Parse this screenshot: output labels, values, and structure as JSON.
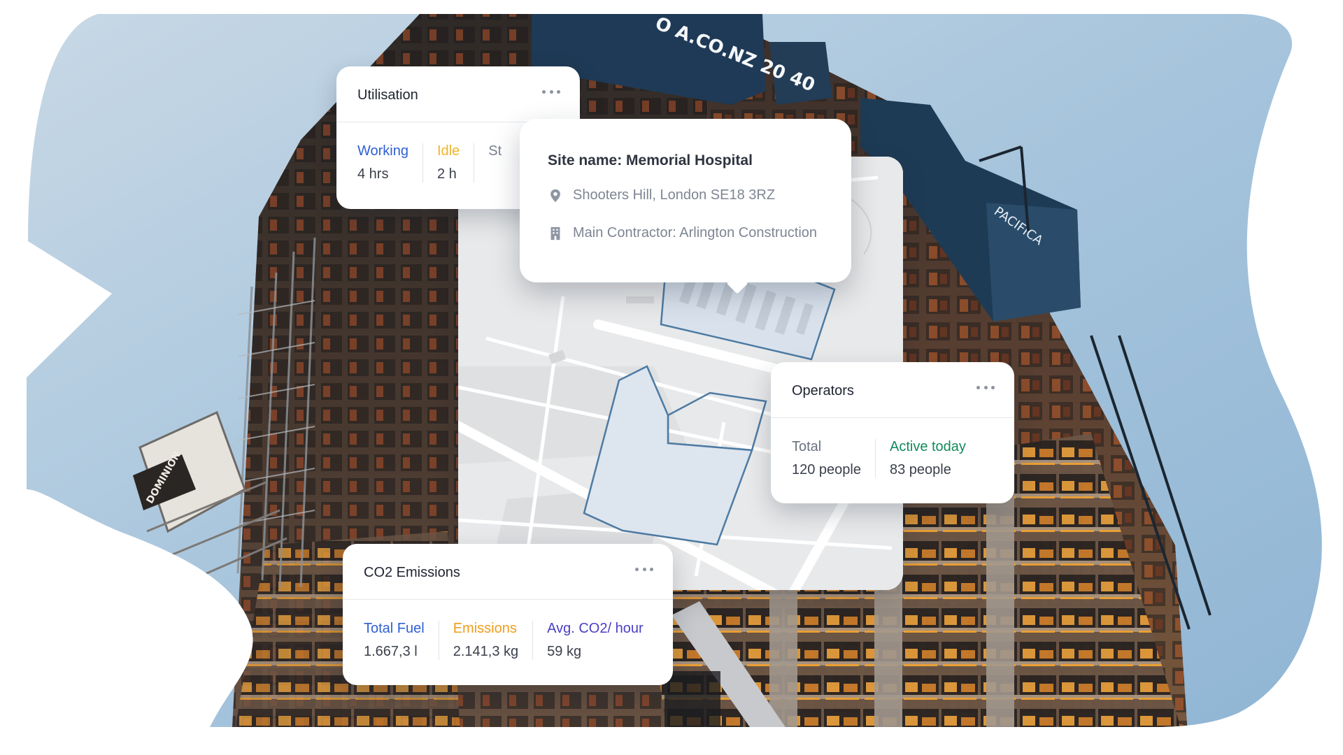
{
  "colors": {
    "working": "#2f5fd6",
    "idle": "#f0b429",
    "standby": "#7b8190",
    "total": "#6b7280",
    "active": "#148a5c",
    "fuel": "#2f5fd6",
    "emissions": "#ef9d1b",
    "avg_co2": "#4a3fc4"
  },
  "utilisation": {
    "title": "Utilisation",
    "menu_icon": "more-horizontal-icon",
    "metrics": [
      {
        "label": "Working",
        "value": "4 hrs"
      },
      {
        "label": "Idle",
        "value": "2 h"
      },
      {
        "label": "St",
        "value": ""
      }
    ]
  },
  "site": {
    "name": "Site name: Memorial Hospital",
    "address": "Shooters Hill, London SE18 3RZ",
    "address_icon": "location-pin-icon",
    "contractor": "Main Contractor: Arlington Construction",
    "contractor_icon": "building-icon"
  },
  "operators": {
    "title": "Operators",
    "menu_icon": "more-horizontal-icon",
    "metrics": [
      {
        "label": "Total",
        "value": "120 people"
      },
      {
        "label": "Active today",
        "value": "83 people"
      }
    ]
  },
  "emissions": {
    "title": "CO2 Emissions",
    "menu_icon": "more-horizontal-icon",
    "metrics": [
      {
        "label": "Total Fuel",
        "value": "1.667,3 l"
      },
      {
        "label": "Emissions",
        "value": "2.141,3 kg"
      },
      {
        "label": "Avg. CO2/ hour",
        "value": "59 kg"
      }
    ]
  },
  "photo": {
    "banner_text": "O A.CO.NZ 20 40",
    "hoist_text": "DOMINION",
    "sign_text": "PACIFICA"
  }
}
